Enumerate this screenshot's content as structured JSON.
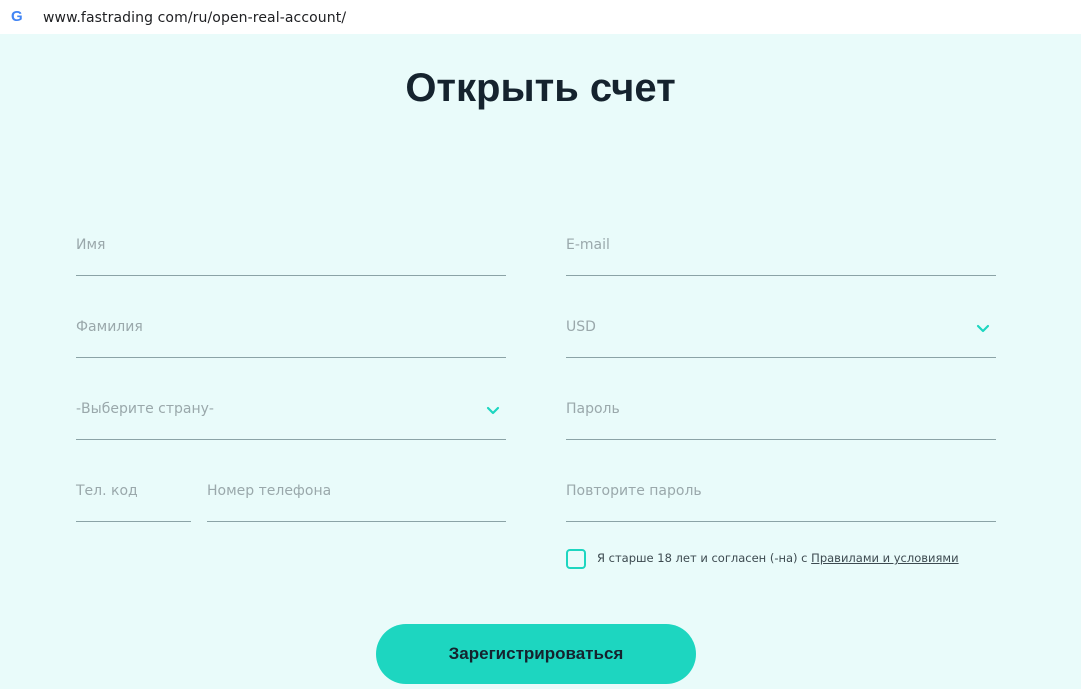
{
  "browser": {
    "url": "www.fastrading com/ru/open-real-account/",
    "icon": "google-g-icon"
  },
  "page": {
    "title": "Открыть счет"
  },
  "form": {
    "first_name_placeholder": "Имя",
    "email_placeholder": "E-mail",
    "last_name_placeholder": "Фамилия",
    "currency_value": "USD",
    "country_placeholder": "-Выберите страну-",
    "password_placeholder": "Пароль",
    "phone_code_placeholder": "Тел. код",
    "phone_number_placeholder": "Номер телефона",
    "repeat_password_placeholder": "Повторите пароль",
    "agree_text": "Я старше 18 лет и согласен (-на) с ",
    "terms_link": "Правилами и условиями",
    "submit_label": "Зарегистрироваться"
  },
  "colors": {
    "accent": "#1dd6c0",
    "background": "#e9fbfa",
    "title": "#15232e"
  }
}
